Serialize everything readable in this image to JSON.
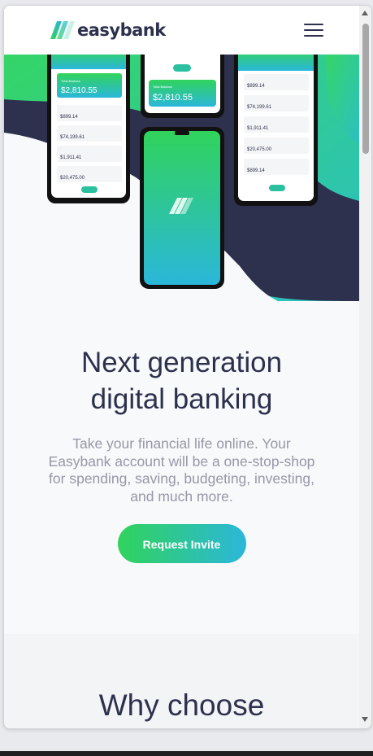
{
  "brand": {
    "name": "easybank"
  },
  "hero": {
    "headline": "Next generation digital banking",
    "description": "Take your financial life online. Your Easybank account will be a one-stop-shop for spending, saving, budgeting, investing, and much more.",
    "cta_label": "Request Invite",
    "phones": {
      "balance": "$2,810.55",
      "amounts_left": [
        "$899.14",
        "$74,199.61",
        "$1,911.41",
        "$20,475.00"
      ],
      "amounts_right": [
        "$899.14",
        "$74,199.61",
        "$1,911.41",
        "$20,475.00",
        "$899.14"
      ]
    }
  },
  "why": {
    "title_partial": "Why choose"
  },
  "icons": [
    "logo-mark-icon",
    "hamburger-menu-icon",
    "transfer-icon",
    "scroll-up-icon",
    "scroll-down-icon"
  ],
  "colors": {
    "dark_blue": "#2d314d",
    "lime_green": "#31d35c",
    "bright_cyan": "#2bb7da",
    "grayish_blue": "#9698a6",
    "light_gray": "#f3f4f6"
  }
}
